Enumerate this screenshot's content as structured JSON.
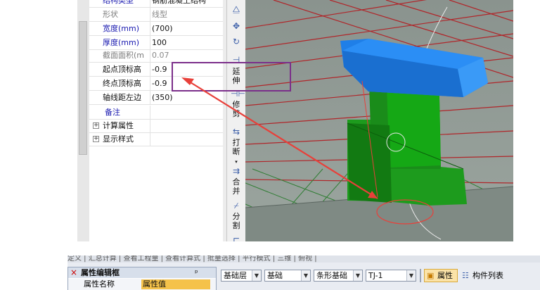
{
  "properties": {
    "rows": [
      {
        "label": "结构类型",
        "value": "钢筋混凝土结构",
        "label_style": "blue",
        "value_style": "normal"
      },
      {
        "label": "形状",
        "value": "线型",
        "label_style": "gray",
        "value_style": "gray"
      },
      {
        "label": "宽度(mm)",
        "value": "(700)",
        "label_style": "blue",
        "value_style": "normal"
      },
      {
        "label": "厚度(mm)",
        "value": "100",
        "label_style": "blue",
        "value_style": "normal"
      },
      {
        "label": "截面面积(m",
        "value": "0.07",
        "label_style": "gray",
        "value_style": "gray"
      },
      {
        "label": "起点顶标高",
        "value": "-0.9",
        "label_style": "blue",
        "value_style": "normal"
      },
      {
        "label": "终点顶标高",
        "value": "-0.9",
        "label_style": "blue",
        "value_style": "normal"
      },
      {
        "label": "轴线距左边",
        "value": "(350)",
        "label_style": "blue",
        "value_style": "normal"
      },
      {
        "label": "备注",
        "value": "",
        "label_style": "blue",
        "value_style": "normal"
      }
    ],
    "groups": [
      {
        "label": "计算属性"
      },
      {
        "label": "显示样式"
      }
    ]
  },
  "vtoolbar": {
    "extend_label": "延伸",
    "trim_label": "修剪",
    "break_label": "打断",
    "merge_label": "合并",
    "split_label": "分割"
  },
  "icons": [
    "mirror-icon",
    "move-icon",
    "rotate-icon",
    "extend-icon",
    "trim-icon",
    "break-icon",
    "merge-icon",
    "split-icon"
  ],
  "colors": {
    "highlight_box": "#7b2f8a",
    "arrow": "#e8403a",
    "slab": "#1f7fe8",
    "column": "#1a8c1a",
    "grid_line": "#b0262a",
    "viewport_bg": "#8e9a93"
  },
  "bottom": {
    "top_strip_text": "定义 | 汇总计算 | 查看工程量 | 查看计算式 | 批量选择 | 平行模式 | 三维 | 俯视 |",
    "panel_title": "属性编辑框",
    "panel_pin": "ᵖ",
    "panel_close": "×",
    "col_name": "属性名称",
    "col_value": "属性值",
    "toolbar": {
      "layer_value": "基础层",
      "category_value": "基础",
      "type_value": "条形基础",
      "element_value": "TJ-1",
      "properties_button": "属性",
      "list_button": "构件列表"
    }
  }
}
